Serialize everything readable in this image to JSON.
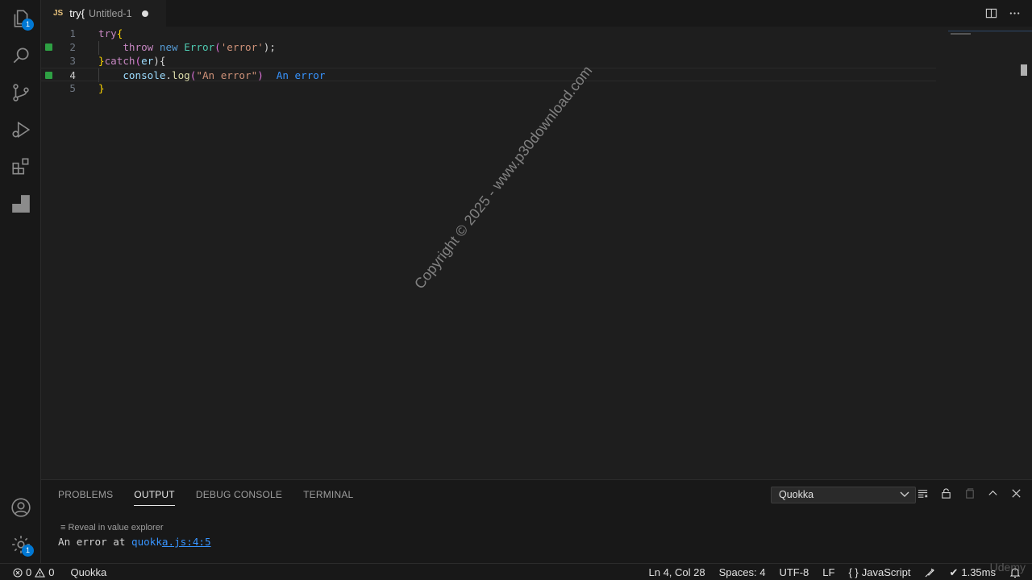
{
  "activity_bar": {
    "explorer_badge": "1",
    "settings_badge": "1"
  },
  "tab": {
    "lang": "JS",
    "title": "try{",
    "description": "Untitled-1"
  },
  "editor": {
    "lines": [
      {
        "num": "1"
      },
      {
        "num": "2"
      },
      {
        "num": "3"
      },
      {
        "num": "4"
      },
      {
        "num": "5"
      }
    ],
    "code": {
      "l1_kw": "try",
      "l1_brace": "{",
      "l2_throw": "throw",
      "l2_new": "new",
      "l2_class": "Error",
      "l2_open": "(",
      "l2_str": "'error'",
      "l2_close": ");",
      "l3_brace": "}",
      "l3_catch": "catch",
      "l3_open": "(",
      "l3_var": "er",
      "l3_close": "){",
      "l4_obj": "console",
      "l4_dot": ".",
      "l4_fn": "log",
      "l4_open": "(",
      "l4_str": "\"An error\"",
      "l4_close": ")",
      "l4_inline_value": "An error",
      "l5_brace": "}"
    },
    "watermark": "Copyright © 2025 - www.p30download.com"
  },
  "panel": {
    "tabs": [
      "PROBLEMS",
      "OUTPUT",
      "DEBUG CONSOLE",
      "TERMINAL"
    ],
    "active_tab": "OUTPUT",
    "select_value": "Quokka",
    "reveal_label": "Reveal in value explorer",
    "output_text": "An error at ",
    "output_link_a": "quokk",
    "output_link_b": "a.js:4:5"
  },
  "statusbar": {
    "errors": "0",
    "warnings": "0",
    "quokka": "Quokka",
    "position": "Ln 4, Col 28",
    "spaces": "Spaces: 4",
    "encoding": "UTF-8",
    "eol": "LF",
    "language": "JavaScript",
    "timing": "1.35ms"
  },
  "udemy_mark": "Udemy",
  "colors": {
    "accent": "#0078d4",
    "link": "#3794ff",
    "gutter_added": "#2ea043"
  }
}
